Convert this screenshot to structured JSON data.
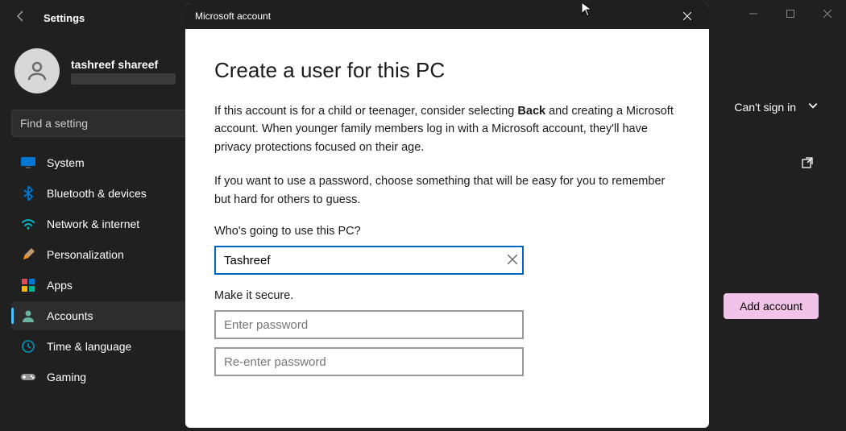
{
  "window": {
    "title": "Settings",
    "user_name": "tashreef shareef",
    "search_placeholder": "Find a setting"
  },
  "sidebar": {
    "items": [
      {
        "id": "system",
        "label": "System",
        "color": "#0078d4"
      },
      {
        "id": "bluetooth",
        "label": "Bluetooth & devices",
        "color": "#0078d4"
      },
      {
        "id": "network",
        "label": "Network & internet",
        "color": "#00b7c3"
      },
      {
        "id": "personalization",
        "label": "Personalization",
        "color": "#b146c2"
      },
      {
        "id": "apps",
        "label": "Apps",
        "color": "#e74856"
      },
      {
        "id": "accounts",
        "label": "Accounts",
        "color": "#00b294"
      },
      {
        "id": "time",
        "label": "Time & language",
        "color": "#0099bc"
      },
      {
        "id": "gaming",
        "label": "Gaming",
        "color": "#929292"
      }
    ],
    "selected": "accounts"
  },
  "content": {
    "cant_sign_in": "Can't sign in",
    "add_account": "Add account"
  },
  "dialog": {
    "title": "Microsoft account",
    "heading": "Create a user for this PC",
    "para1_pre": "If this account is for a child or teenager, consider selecting ",
    "para1_bold": "Back",
    "para1_post": " and creating a Microsoft account. When younger family members log in with a Microsoft account, they'll have privacy protections focused on their age.",
    "para2": "If you want to use a password, choose something that will be easy for you to remember but hard for others to guess.",
    "who_label": "Who's going to use this PC?",
    "username_value": "Tashreef",
    "secure_label": "Make it secure.",
    "pwd_placeholder": "Enter password",
    "pwd2_placeholder": "Re-enter password"
  }
}
